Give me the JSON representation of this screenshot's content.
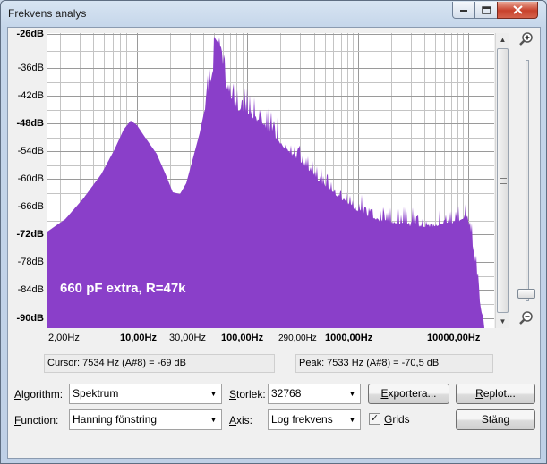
{
  "window": {
    "title": "Frekvens analys"
  },
  "plot": {
    "annotation": "660 pF extra, R=47k",
    "fill_color": "#8a3fc9",
    "db_labels": [
      {
        "text": "-26dB",
        "bold": true
      },
      {
        "text": "-36dB",
        "bold": false
      },
      {
        "text": "-42dB",
        "bold": false
      },
      {
        "text": "-48dB",
        "bold": true
      },
      {
        "text": "-54dB",
        "bold": false
      },
      {
        "text": "-60dB",
        "bold": false
      },
      {
        "text": "-66dB",
        "bold": false
      },
      {
        "text": "-72dB",
        "bold": true
      },
      {
        "text": "-78dB",
        "bold": false
      },
      {
        "text": "-84dB",
        "bold": false
      },
      {
        "text": "-90dB",
        "bold": true
      }
    ],
    "hz_labels": [
      {
        "text": "2,00Hz",
        "style": "normal"
      },
      {
        "text": "10,00Hz",
        "style": "bold"
      },
      {
        "text": "30,00Hz",
        "style": "normal"
      },
      {
        "text": "100,00Hz",
        "style": "bold"
      },
      {
        "text": "290,00Hz",
        "style": "small"
      },
      {
        "text": "1000,00Hz",
        "style": "bold"
      },
      {
        "text": "10000,00Hz",
        "style": "bold"
      }
    ]
  },
  "readouts": {
    "cursor": "Cursor: 7534 Hz (A#8) = -69 dB",
    "peak": "Peak: 7533 Hz (A#8) = -70,5 dB"
  },
  "controls": {
    "algorithm": {
      "label_ul": "A",
      "label_rest": "lgorithm:",
      "value": "Spektrum"
    },
    "size": {
      "label_ul": "S",
      "label_rest": "torlek:",
      "value": "32768"
    },
    "function": {
      "label_ul": "F",
      "label_rest": "unction:",
      "value": "Hanning  fönstring"
    },
    "axis": {
      "label_ul": "A",
      "label_rest": "xis:",
      "value": "Log frekvens"
    },
    "grids": {
      "label_ul": "G",
      "label_rest": "rids",
      "checked": "✓"
    },
    "export_button": {
      "label_ul": "E",
      "label_rest": "xportera..."
    },
    "replot_button": {
      "label_ul": "R",
      "label_rest": "eplot..."
    },
    "close_button": {
      "label": "Stäng"
    }
  }
}
